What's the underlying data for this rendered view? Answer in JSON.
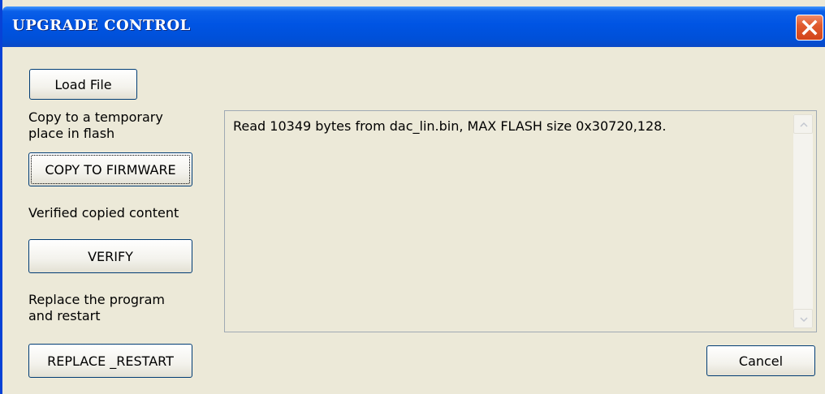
{
  "window": {
    "title": "UPGRADE CONTROL",
    "close_icon": "close-icon"
  },
  "buttons": {
    "load_file": "Load File",
    "copy_to_firmware": "COPY TO FIRMWARE",
    "verify": "VERIFY",
    "replace_restart": "REPLACE _RESTART",
    "cancel": "Cancel"
  },
  "labels": {
    "copy_line1": "Copy to a temporary",
    "copy_line2": "place in flash",
    "verify": "Verified copied content",
    "replace_line1": "Replace the program",
    "replace_line2": "and restart"
  },
  "log": {
    "text": "Read 10349 bytes from dac_lin.bin, MAX FLASH size 0x30720,128."
  },
  "colors": {
    "titlebar": "#0054e3",
    "dialog_bg": "#ece9d8",
    "close_button": "#e05a2e",
    "button_border": "#003c74"
  }
}
